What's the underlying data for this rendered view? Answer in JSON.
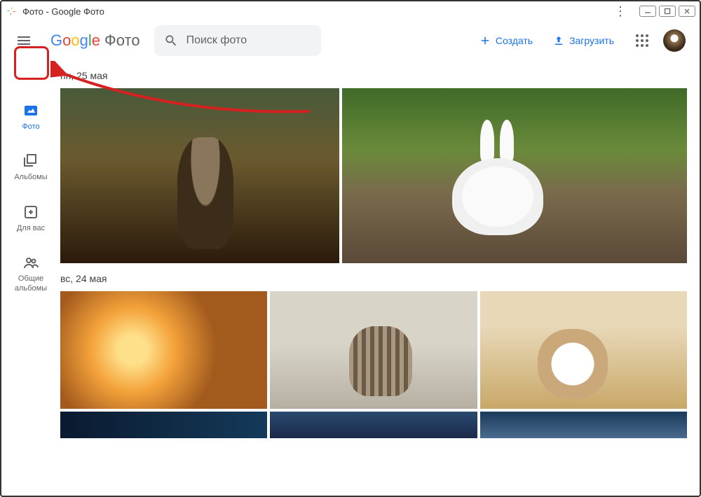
{
  "window": {
    "title": "Фото - Google Фото"
  },
  "logo": {
    "letters": [
      "G",
      "o",
      "o",
      "g",
      "l",
      "e"
    ],
    "product": "Фото"
  },
  "search": {
    "placeholder": "Поиск фото"
  },
  "actions": {
    "create": "Создать",
    "upload": "Загрузить"
  },
  "sidebar": {
    "items": [
      {
        "label": "Фото"
      },
      {
        "label": "Альбомы"
      },
      {
        "label": "Для вас"
      },
      {
        "label": "Общие альбомы"
      }
    ]
  },
  "groups": [
    {
      "date": "пн, 25 мая"
    },
    {
      "date": "вс, 24 мая"
    }
  ]
}
